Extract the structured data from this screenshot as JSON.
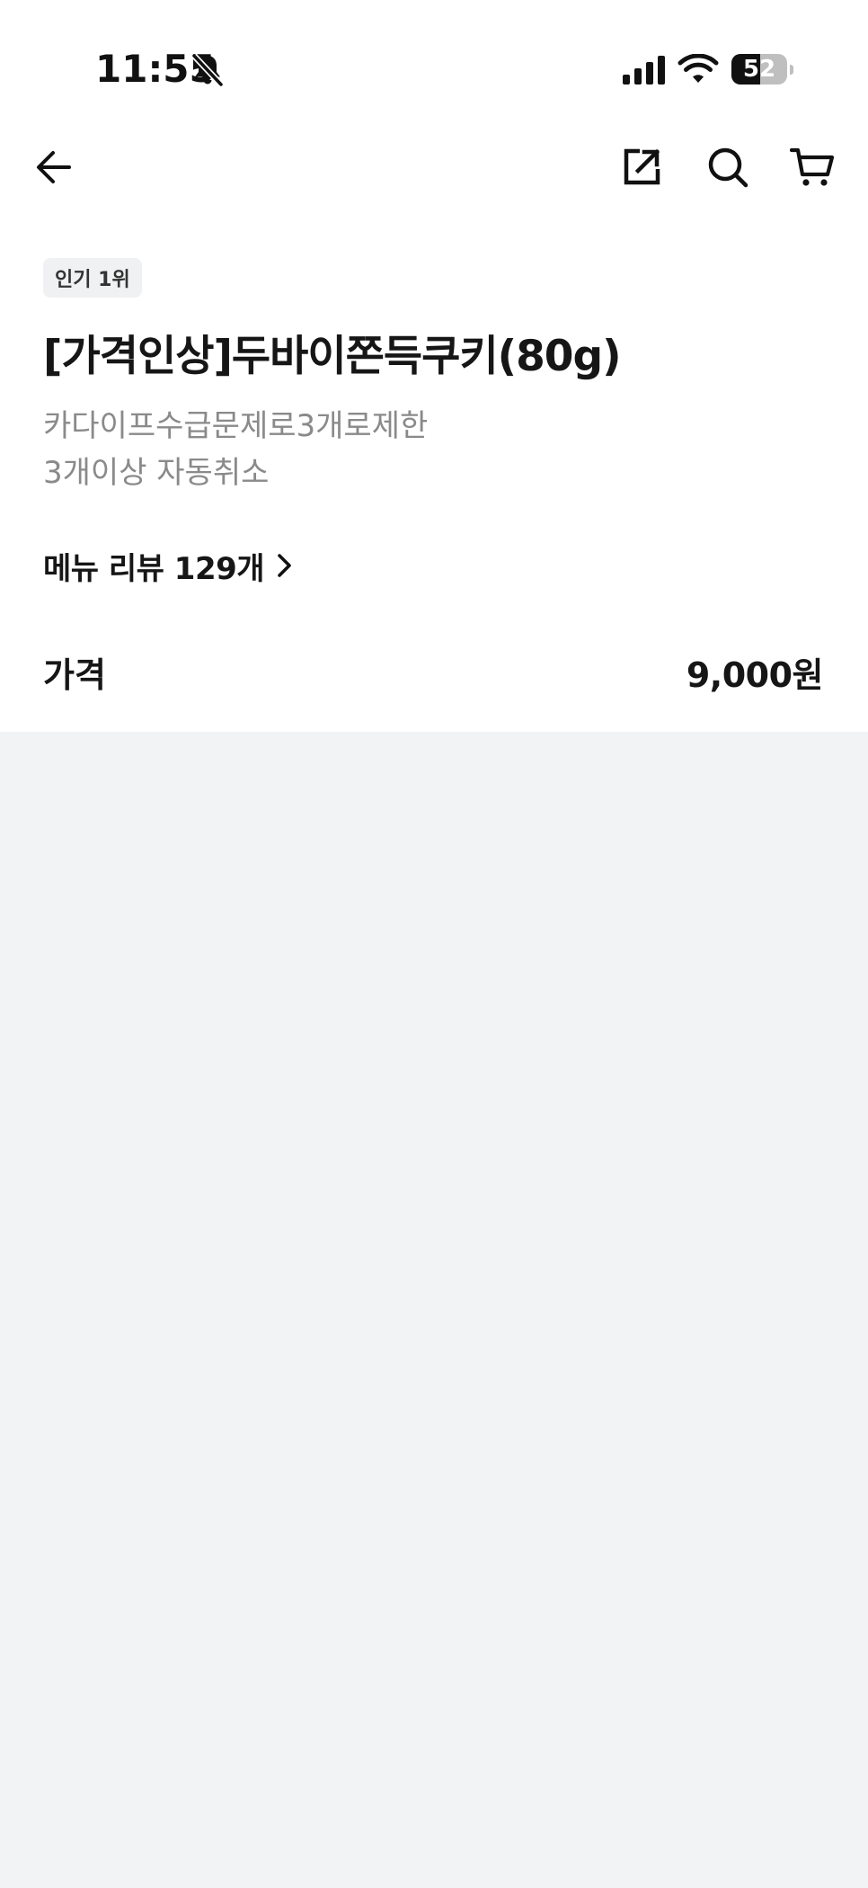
{
  "status_bar": {
    "time": "11:55",
    "battery_level": 52,
    "battery_label": "52",
    "icons": [
      "bell-muted-icon",
      "signal-icon",
      "wifi-icon",
      "battery-icon"
    ]
  },
  "nav": {
    "back_icon": "arrow-left-icon",
    "share_icon": "share-icon",
    "search_icon": "search-icon",
    "cart_icon": "cart-icon"
  },
  "product": {
    "badge": "인기 1위",
    "title": "[가격인상]두바이쫀득쿠키(80g)",
    "description_lines": [
      "카다이프수급문제로3개로제한",
      "3개이상 자동취소"
    ],
    "review_link": "메뉴 리뷰 129개",
    "price_label": "가격",
    "price_value": "9,000원"
  },
  "colors": {
    "background": "#f2f3f5",
    "sheet": "#ffffff",
    "text_primary": "#161616",
    "text_secondary": "#8a8a8a",
    "badge_bg": "#f0f1f3"
  }
}
